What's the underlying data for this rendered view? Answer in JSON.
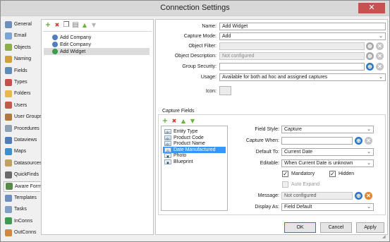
{
  "window": {
    "title": "Connection Settings",
    "close_glyph": "✕"
  },
  "nav": {
    "items": [
      {
        "label": "General",
        "icon": "general-icon",
        "color": "#6a8fc1"
      },
      {
        "label": "Email",
        "icon": "email-icon",
        "color": "#7aa6d6"
      },
      {
        "label": "Objects",
        "icon": "objects-icon",
        "color": "#8bb04a"
      },
      {
        "label": "Naming",
        "icon": "naming-icon",
        "color": "#d0a03a"
      },
      {
        "label": "Fields",
        "icon": "fields-icon",
        "color": "#5c8db8"
      },
      {
        "label": "Types",
        "icon": "types-icon",
        "color": "#c94f4f"
      },
      {
        "label": "Folders",
        "icon": "folders-icon",
        "color": "#e8b84a"
      },
      {
        "label": "Users",
        "icon": "users-icon",
        "color": "#c25a4a"
      },
      {
        "label": "User Groups",
        "icon": "user-groups-icon",
        "color": "#b0783c"
      },
      {
        "label": "Procedures",
        "icon": "procedures-icon",
        "color": "#8da0b6"
      },
      {
        "label": "Dataviews",
        "icon": "dataviews-icon",
        "color": "#4e7cbc"
      },
      {
        "label": "Maps",
        "icon": "maps-icon",
        "color": "#3a8fd0"
      },
      {
        "label": "Datasources",
        "icon": "datasources-icon",
        "color": "#c0a05a"
      },
      {
        "label": "QuickFinds",
        "icon": "quickfinds-icon",
        "color": "#6b6b6b"
      },
      {
        "label": "Aware Forms",
        "icon": "aware-forms-icon",
        "color": "#5a8a4a"
      },
      {
        "label": "Templates",
        "icon": "templates-icon",
        "color": "#6c8fbf"
      },
      {
        "label": "Tasks",
        "icon": "tasks-icon",
        "color": "#7f9fc6"
      },
      {
        "label": "InConns",
        "icon": "inconns-icon",
        "color": "#3f9a4f"
      },
      {
        "label": "OutConns",
        "icon": "outconns-icon",
        "color": "#d08a3a"
      }
    ],
    "selected": "Aware Forms"
  },
  "list": {
    "items": [
      {
        "label": "Add Company",
        "selected": false
      },
      {
        "label": "Edit Company",
        "selected": false
      },
      {
        "label": "Add Widget",
        "selected": true
      }
    ]
  },
  "form": {
    "name_label": "Name:",
    "name_value": "Add Widget",
    "capture_mode_label": "Capture Mode:",
    "capture_mode_value": "Add",
    "object_filter_label": "Object Filter:",
    "object_filter_value": "",
    "object_description_label": "Object Description:",
    "object_description_value": "Not configured",
    "group_security_label": "Group Security:",
    "group_security_value": "",
    "usage_label": "Usage:",
    "usage_value": "Available for both ad hoc and assigned captures",
    "icon_label": "Icon:"
  },
  "capture_fields": {
    "title": "Capture Fields",
    "items": [
      {
        "label": "Entity Type",
        "icon": "text-field-icon",
        "glyph": "abc"
      },
      {
        "label": "Product Code",
        "icon": "text-field-icon",
        "glyph": "abc"
      },
      {
        "label": "Product Name",
        "icon": "text-field-icon",
        "glyph": "abc"
      },
      {
        "label": "Date Manufactured",
        "icon": "date-field-icon",
        "glyph": "31"
      },
      {
        "label": "Photo",
        "icon": "image-field-icon",
        "glyph": "▣"
      },
      {
        "label": "Blueprint",
        "icon": "image-field-icon",
        "glyph": "▣"
      }
    ],
    "selected": "Date Manufactured",
    "field_style_label": "Field Style:",
    "field_style_value": "Capture",
    "capture_when_label": "Capture When:",
    "capture_when_value": "",
    "default_to_label": "Default To:",
    "default_to_value": "Current Date",
    "editable_label": "Editable:",
    "editable_value": "When Current Date is unknown",
    "mandatory_label": "Mandatory",
    "mandatory_checked": true,
    "hidden_label": "Hidden",
    "hidden_checked": true,
    "auto_expand_label": "Auto Expand",
    "auto_expand_checked": false,
    "message_label": "Message:",
    "message_value": "Not configured",
    "display_as_label": "Display As:",
    "display_as_value": "Field Default"
  },
  "buttons": {
    "ok": "OK",
    "cancel": "Cancel",
    "apply": "Apply"
  },
  "glyphs": {
    "add": "+",
    "remove": "✖",
    "up": "▲",
    "down": "▼",
    "copy": "❐",
    "paste": "▤",
    "dropdown": "⌄",
    "check": "✓",
    "info": "i",
    "clear": "✕",
    "edit": "⊕"
  },
  "colors": {
    "accent": "#3399ff",
    "add": "#5aa832",
    "remove": "#d23b2b",
    "move": "#6ab23a"
  }
}
